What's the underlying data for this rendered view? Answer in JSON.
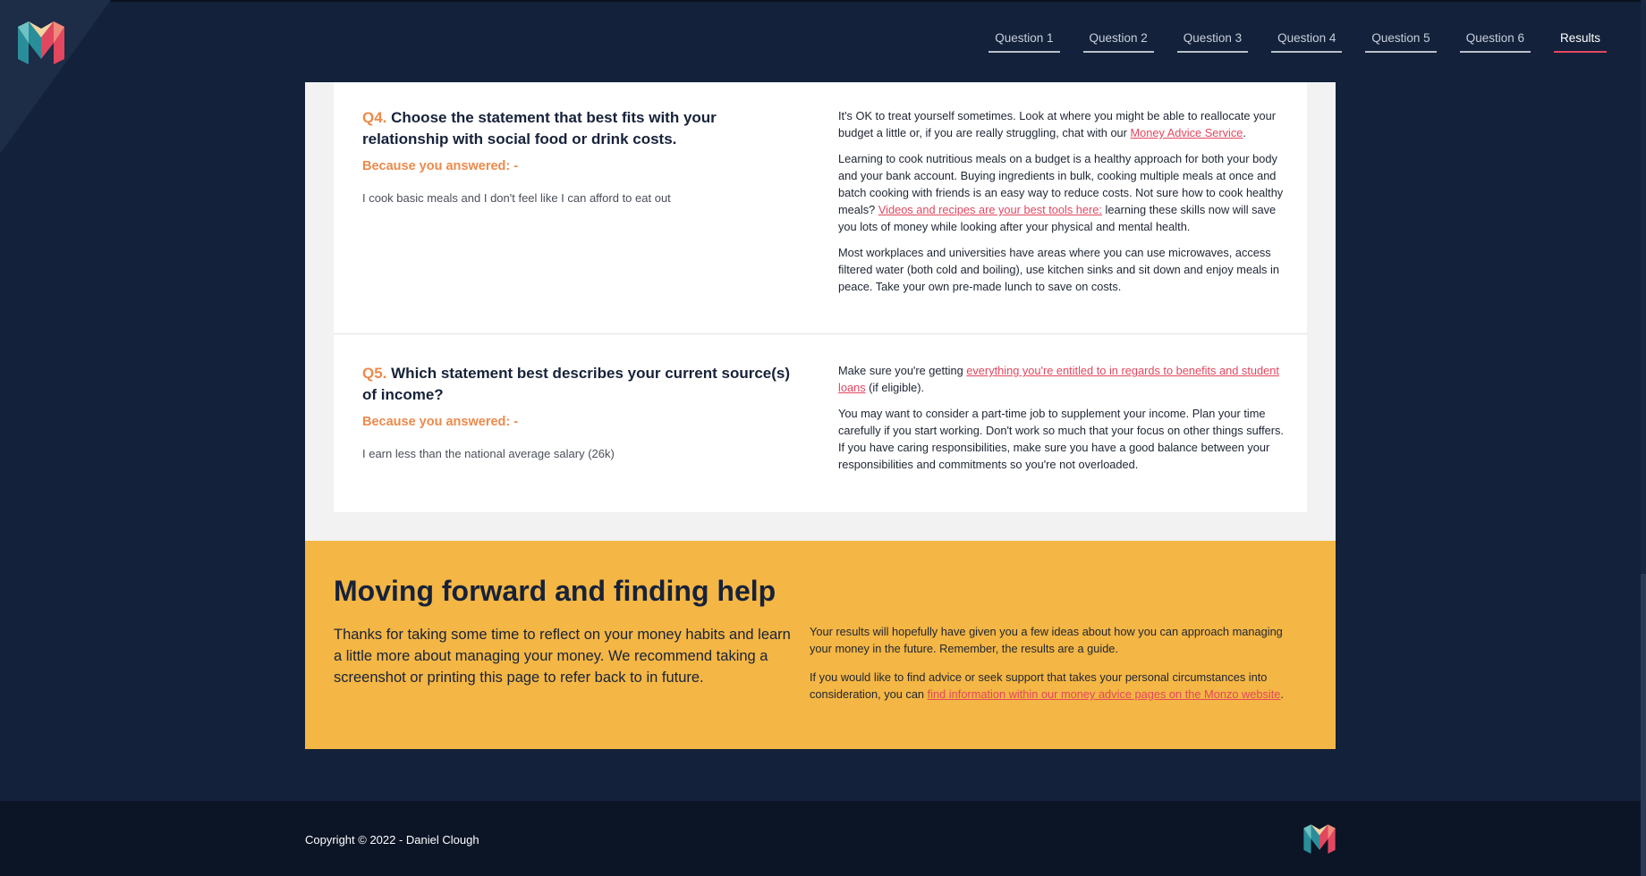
{
  "nav": {
    "items": [
      "Question 1",
      "Question 2",
      "Question 3",
      "Question 4",
      "Question 5",
      "Question 6",
      "Results"
    ],
    "active_index": 6
  },
  "q4": {
    "num": "Q4.",
    "title": "Choose the statement that best fits with your relationship with social food or drink costs.",
    "because": "Because you answered: -",
    "answer": "I cook basic meals and I don't feel like I can afford to eat out",
    "p1_text": "It's OK to treat yourself sometimes. Look at where you might be able to reallocate your budget a little or, if you are really struggling, chat with our ",
    "p1_link": "Money Advice Service",
    "p1_end": ".",
    "p2_text": "Learning to cook nutritious meals on a budget is a healthy approach for both your body and your bank account. Buying ingredients in bulk, cooking multiple meals at once and batch cooking with friends is an easy way to reduce costs. Not sure how to cook healthy meals? ",
    "p2_link": "Videos and recipes are your best tools here:",
    "p2_end": " learning these skills now will save you lots of money while looking after your physical and mental health.",
    "p3_text": "Most workplaces and universities have areas where you can use microwaves, access filtered water (both cold and boiling), use kitchen sinks and sit down and enjoy meals in peace. Take your own pre-made lunch to save on costs."
  },
  "q5": {
    "num": "Q5.",
    "title": "Which statement best describes your current source(s) of income?",
    "because": "Because you answered: -",
    "answer": "I earn less than the national average salary (26k)",
    "p1_text": "Make sure you're getting ",
    "p1_link": "everything you're entitled to in regards to benefits and student loans",
    "p1_end": " (if eligible).",
    "p2_text": "You may want to consider a part-time job to supplement your income. Plan your time carefully if you start working. Don't work so much that your focus on other things suffers. If you have caring responsibilities, make sure you have a good balance between your responsibilities and commitments so you're not overloaded."
  },
  "help": {
    "title": "Moving forward and finding help",
    "body": "Thanks for taking some time to reflect on your money habits and learn a little more about managing your money. We recommend taking a screenshot or printing this page to refer back to in future.",
    "p1": "Your results will hopefully have given you a few ideas about how you can approach managing your money in the future. Remember, the results are a guide.",
    "p2_text": "If you would like to find advice or seek support that takes your personal circumstances into consideration, you can ",
    "p2_link": "find information within our money advice pages on the Monzo website",
    "p2_end": "."
  },
  "footer": {
    "copyright": "Copyright © 2022 - Daniel Clough"
  },
  "colors": {
    "background": "#13213a",
    "accent_orange": "#ec8a4c",
    "link_red": "#e2475f",
    "help_yellow": "#f4b644",
    "footer": "#0c1526"
  },
  "icons": {
    "logo": "monzo-m-logo"
  }
}
